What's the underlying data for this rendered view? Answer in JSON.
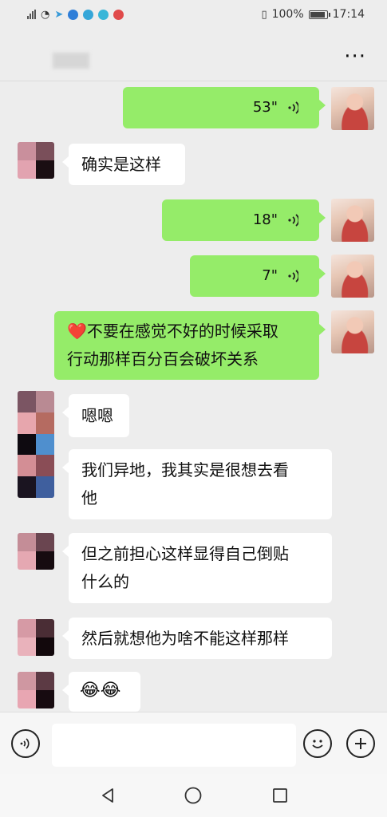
{
  "status_bar": {
    "battery_percent": "100%",
    "time": "17:14"
  },
  "header": {
    "more_icon": "more-dots-icon"
  },
  "messages": [
    {
      "side": "sent",
      "type": "voice",
      "duration": "53\""
    },
    {
      "side": "received",
      "type": "text",
      "text": "确实是这样"
    },
    {
      "side": "sent",
      "type": "voice",
      "duration": "18\""
    },
    {
      "side": "sent",
      "type": "voice",
      "duration": "7\""
    },
    {
      "side": "sent",
      "type": "text",
      "emoji": "❤️",
      "lines": [
        "不要在感觉不好的时候采取",
        "行动那样百分百会破坏关系"
      ]
    },
    {
      "side": "received",
      "type": "text",
      "text": "嗯嗯"
    },
    {
      "side": "received",
      "type": "text",
      "lines": [
        "我们异地，我其实是很想去看",
        "他"
      ]
    },
    {
      "side": "received",
      "type": "text",
      "lines": [
        "但之前担心这样显得自己倒贴",
        "什么的"
      ]
    },
    {
      "side": "received",
      "type": "text",
      "text": "然后就想他为啥不能这样那样"
    },
    {
      "side": "received",
      "type": "emoji",
      "text": "😂😂"
    }
  ],
  "colors": {
    "background": "#ededed",
    "sent_bubble": "#95ec69",
    "received_bubble": "#ffffff"
  },
  "input_bar": {
    "voice_icon": "voice-input-icon",
    "emoji_icon": "emoji-icon",
    "plus_icon": "plus-icon",
    "text_value": ""
  },
  "nav_bar": {
    "back_icon": "back-triangle-icon",
    "home_icon": "home-circle-icon",
    "recents_icon": "recents-square-icon"
  }
}
